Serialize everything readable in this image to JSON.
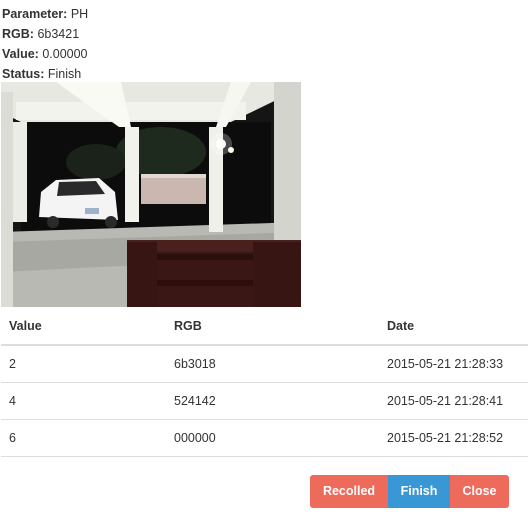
{
  "info": {
    "parameter_label": "Parameter:",
    "parameter_value": "PH",
    "rgb_label": "RGB:",
    "rgb_value": "6b3421",
    "value_label": "Value:",
    "value_value": "0.00000",
    "status_label": "Status:",
    "status_value": "Finish"
  },
  "table": {
    "headers": [
      "Value",
      "RGB",
      "Date"
    ],
    "rows": [
      {
        "value": "2",
        "rgb": "6b3018",
        "date": "2015-05-21 21:28:33"
      },
      {
        "value": "4",
        "rgb": "524142",
        "date": "2015-05-21 21:28:41"
      },
      {
        "value": "6",
        "rgb": "000000",
        "date": "2015-05-21 21:28:52"
      }
    ]
  },
  "buttons": {
    "recolled": "Recolled",
    "finish": "Finish",
    "close": "Close"
  },
  "colors": {
    "danger": "#ee6a5b",
    "primary": "#3a97d6"
  }
}
